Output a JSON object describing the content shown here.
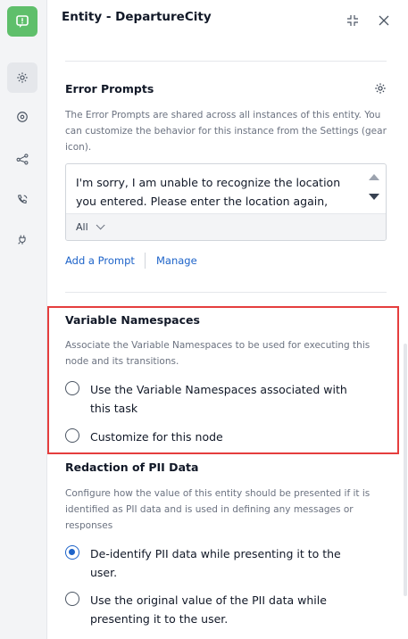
{
  "header": {
    "title": "Entity - DepartureCity"
  },
  "error_prompts": {
    "title": "Error Prompts",
    "description": "The Error Prompts are shared across all instances of this entity. You can customize the behavior for this instance from the Settings (gear icon).",
    "prompt_text": "I'm sorry, I am unable to recognize the location you entered. Please enter the location again,",
    "language_filter": "All",
    "add_prompt_label": "Add a Prompt",
    "manage_label": "Manage"
  },
  "variable_namespaces": {
    "title": "Variable Namespaces",
    "description": "Associate the Variable Namespaces to be used for executing this node and its transitions.",
    "options": [
      {
        "label": "Use the Variable Namespaces associated with this task",
        "selected": false
      },
      {
        "label": "Customize for this node",
        "selected": false
      }
    ]
  },
  "pii_redaction": {
    "title": "Redaction of PII Data",
    "description": "Configure how the value of this entity should be presented if it is identified as PII data and is used in defining any messages or responses",
    "options": [
      {
        "label": "De-identify PII data while presenting it to the user.",
        "selected": true
      },
      {
        "label": "Use the original value of the PII data while presenting it to the user.",
        "selected": false
      }
    ]
  },
  "colors": {
    "brand": "#5fbf6b",
    "accent": "#1d63c9",
    "highlight": "#e53e3e"
  }
}
